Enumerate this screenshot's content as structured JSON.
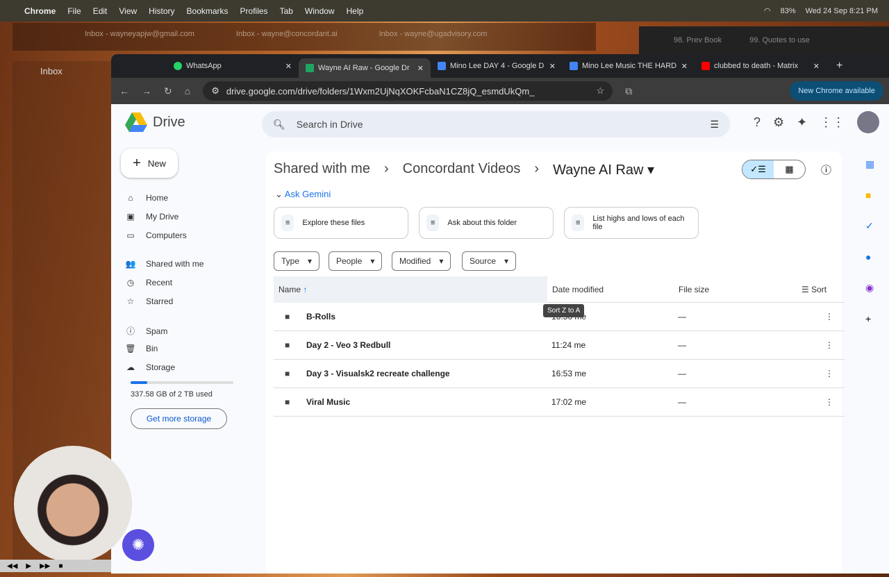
{
  "menubar": {
    "app": "Chrome",
    "items": [
      "File",
      "Edit",
      "View",
      "History",
      "Bookmarks",
      "Profiles",
      "Tab",
      "Window",
      "Help"
    ],
    "battery": "83%",
    "datetime": "Wed 24 Sep  8:21 PM"
  },
  "back_window": {
    "tabs": [
      "Inbox - wayneyapjw@gmail.com",
      "Inbox - wayne@concordant.ai",
      "Inbox - wayne@ugadvisory.com"
    ],
    "other_tabs": [
      "98. Prev Book",
      "99. Quotes to use"
    ],
    "mail_title": "Inbox"
  },
  "tabs": [
    {
      "title": "WhatsApp",
      "color": "#25d366"
    },
    {
      "title": "Wayne AI Raw - Google Dr",
      "color": "#1fa463"
    },
    {
      "title": "Mino Lee DAY 4 - Google D",
      "color": "#4285f4"
    },
    {
      "title": "Mino Lee Music THE HARD",
      "color": "#4285f4"
    },
    {
      "title": "clubbed to death - Matrix",
      "color": "#ff0000"
    }
  ],
  "url": "drive.google.com/drive/folders/1Wxm2UjNqXOKFcbaN1CZ8jQ_esmdUkQm_",
  "new_chrome": "New Chrome available",
  "drive": {
    "logo": "Drive",
    "search_placeholder": "Search in Drive",
    "new": "New",
    "nav": [
      {
        "label": "Home",
        "icon": "⌂"
      },
      {
        "label": "My Drive",
        "icon": "▣"
      },
      {
        "label": "Computers",
        "icon": "▭"
      },
      {
        "label": "Shared with me",
        "icon": "👥"
      },
      {
        "label": "Recent",
        "icon": "◷"
      },
      {
        "label": "Starred",
        "icon": "☆"
      },
      {
        "label": "Spam",
        "icon": "ⓘ"
      },
      {
        "label": "Bin",
        "icon": "🗑"
      },
      {
        "label": "Storage",
        "icon": "☁"
      }
    ],
    "storage_text": "337.58 GB of 2 TB used",
    "storage_fraction": 0.165,
    "get_storage": "Get more storage",
    "breadcrumb": [
      "Shared with me",
      "Concordant Videos",
      "Wayne AI Raw"
    ],
    "ask_gemini": "Ask Gemini",
    "gemini_cards": [
      "Explore these files",
      "Ask about this folder",
      "List highs and lows of each file"
    ],
    "filters": [
      "Type",
      "People",
      "Modified",
      "Source"
    ],
    "columns": {
      "name": "Name",
      "date": "Date modified",
      "size": "File size",
      "sort": "Sort"
    },
    "tooltip": "Sort Z to A",
    "rows": [
      {
        "name": "B-Rolls",
        "date": "16:56 me",
        "size": "—"
      },
      {
        "name": "Day 2 - Veo 3 Redbull",
        "date": "11:24 me",
        "size": "—"
      },
      {
        "name": "Day 3 - Visualsk2 recreate challenge",
        "date": "16:53 me",
        "size": "—"
      },
      {
        "name": "Viral Music",
        "date": "17:02 me",
        "size": "—"
      }
    ]
  }
}
